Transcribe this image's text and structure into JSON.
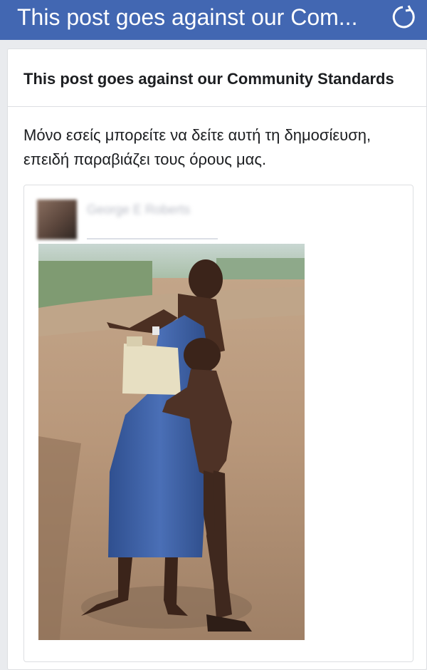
{
  "topbar": {
    "title": "This post goes against our Com...",
    "refresh_icon": "refresh-icon",
    "color": "#4267b2"
  },
  "card": {
    "header_title": "This post goes against our Community Standards",
    "body_text": "Μόνο εσείς μπορείτε να δείτε αυτή τη δημοσίευση, επειδή παραβιάζει τους όρους μας."
  },
  "post": {
    "author_name": "George E Roberts",
    "photo_icon": "post-photo"
  }
}
